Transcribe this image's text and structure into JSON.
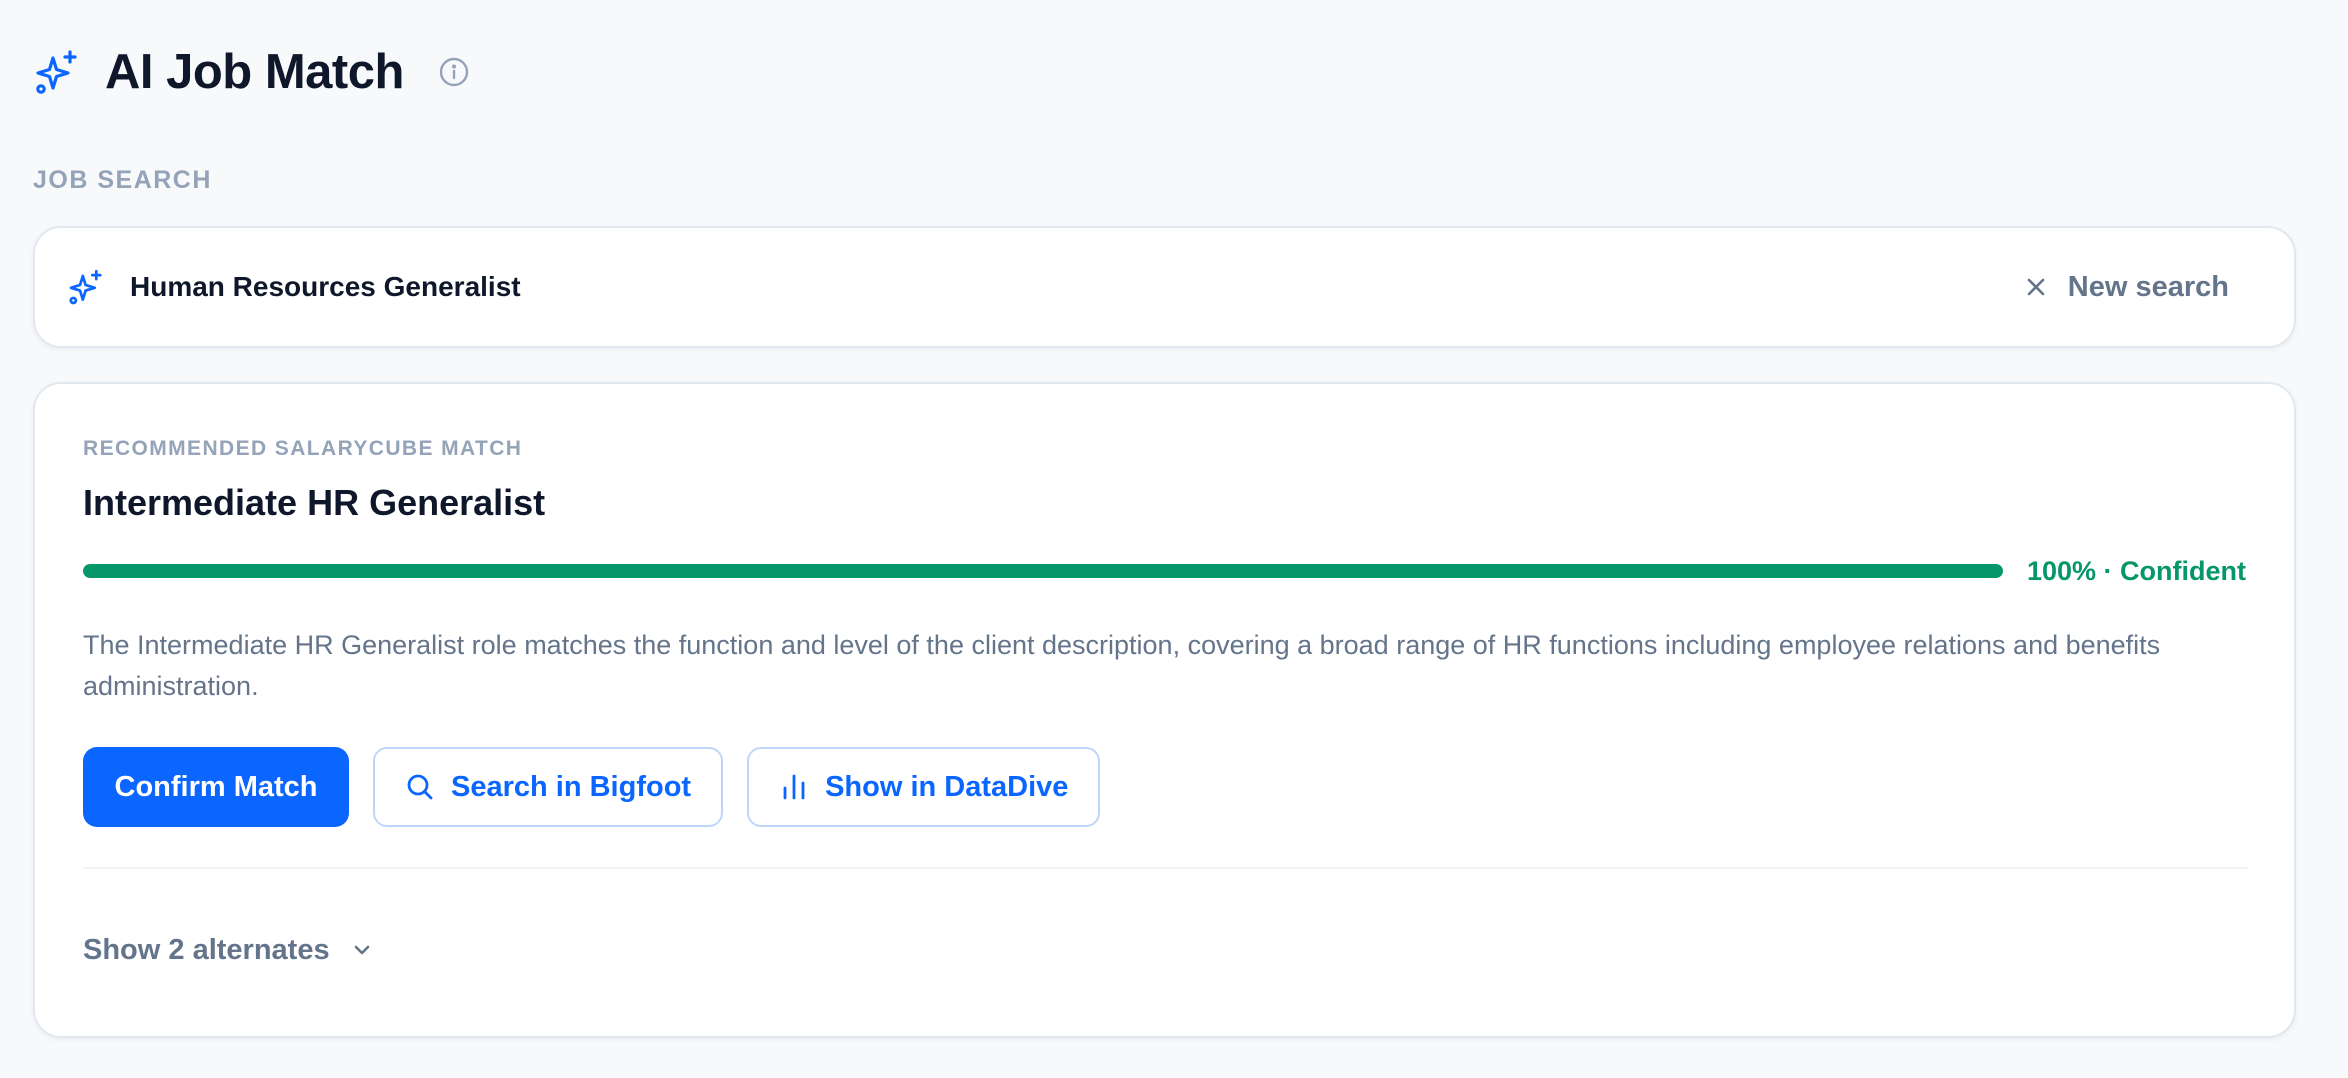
{
  "header": {
    "title": "AI Job Match",
    "title_icon": "sparkles-icon",
    "info_icon": "info-icon"
  },
  "search": {
    "section_label": "JOB SEARCH",
    "query": "Human Resources Generalist",
    "new_search_label": "New search",
    "icon": "sparkles-icon",
    "clear_icon": "close-icon"
  },
  "result": {
    "eyebrow": "RECOMMENDED SALARYCUBE MATCH",
    "title": "Intermediate HR Generalist",
    "confidence_percent": 100,
    "confidence_label": "100% · Confident",
    "description": "The Intermediate HR Generalist role matches the function and level of the client description, covering a broad range of HR functions including employee relations and benefits administration.",
    "actions": {
      "confirm_label": "Confirm Match",
      "bigfoot_label": "Search in Bigfoot",
      "datadive_label": "Show in DataDive"
    },
    "alternates_label": "Show 2 alternates"
  },
  "colors": {
    "accent": "#0a66ff",
    "success": "#059669",
    "muted": "#94a3b8",
    "text": "#0f172a",
    "secondary_text": "#64748b"
  }
}
